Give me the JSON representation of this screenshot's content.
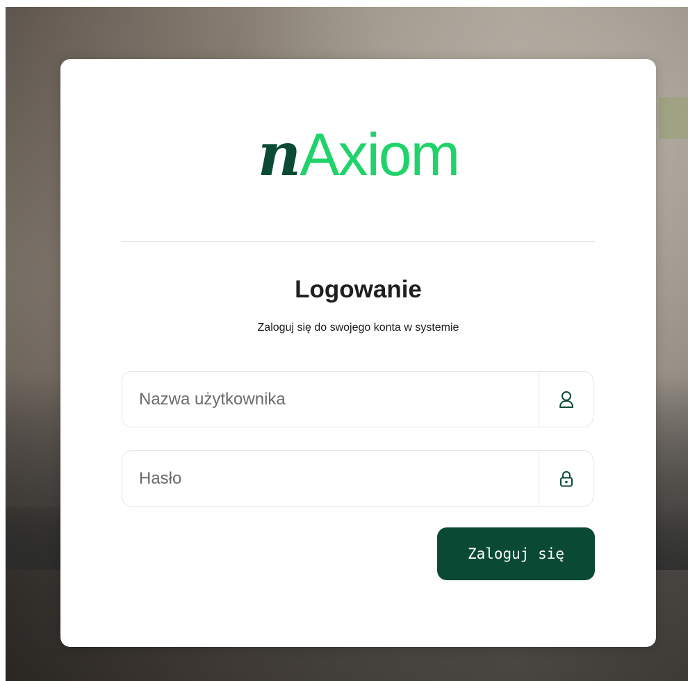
{
  "brand": {
    "logo_prefix": "n",
    "logo_rest": "Axiom",
    "prefix_color": "#0b4a33",
    "accent_color": "#1fd36a"
  },
  "login": {
    "title": "Logowanie",
    "subtitle": "Zaloguj się do swojego konta w systemie",
    "username_field": {
      "placeholder": "Nazwa użytkownika",
      "value": "",
      "icon": "user-icon"
    },
    "password_field": {
      "placeholder": "Hasło",
      "value": "",
      "icon": "lock-icon"
    },
    "submit_label": "Zaloguj się",
    "button_color": "#0a4a35"
  }
}
